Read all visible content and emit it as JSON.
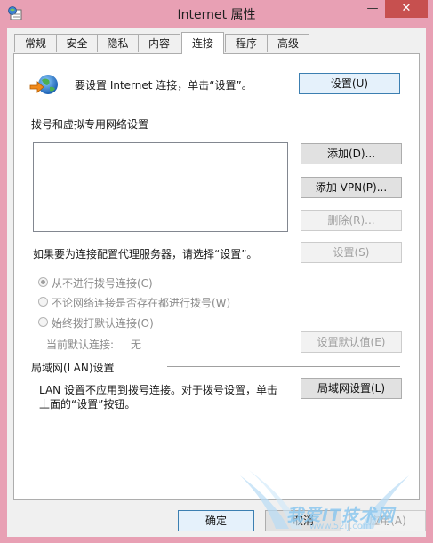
{
  "window": {
    "title": "Internet 属性",
    "minimize_glyph": "—",
    "close_glyph": "✕"
  },
  "tabs": [
    {
      "label": "常规",
      "active": false
    },
    {
      "label": "安全",
      "active": false
    },
    {
      "label": "隐私",
      "active": false
    },
    {
      "label": "内容",
      "active": false
    },
    {
      "label": "连接",
      "active": true
    },
    {
      "label": "程序",
      "active": false
    },
    {
      "label": "高级",
      "active": false
    }
  ],
  "setup": {
    "text": "要设置 Internet 连接，单击“设置”。",
    "button": "设置(U)",
    "icon": "internet-connection-globe-icon"
  },
  "dialup": {
    "header": "拨号和虚拟专用网络设置",
    "add_button": "添加(D)...",
    "add_vpn_button": "添加 VPN(P)...",
    "remove_button": "删除(R)...",
    "proxy_text": "如果要为连接配置代理服务器，请选择“设置”。",
    "settings_button": "设置(S)",
    "radio_never": "从不进行拨号连接(C)",
    "radio_when_no_network": "不论网络连接是否存在都进行拨号(W)",
    "radio_always": "始终拨打默认连接(O)",
    "selected": "never",
    "current_default_label": "当前默认连接:",
    "current_default_value": "无",
    "set_default_button": "设置默认值(E)"
  },
  "lan": {
    "header": "局域网(LAN)设置",
    "text_line1": "LAN 设置不应用到拨号连接。对于拨号设置，单击",
    "text_line2": "上面的“设置”按钮。",
    "button": "局域网设置(L)"
  },
  "footer": {
    "ok": "确定",
    "cancel": "取消",
    "apply": "应用(A)"
  },
  "watermark": {
    "text": "我爱IT技术网",
    "url": "www.52ij.com"
  },
  "colors": {
    "window_frame": "#e8a0b4",
    "close_button": "#c7504f",
    "default_button_border": "#3c7fb1"
  }
}
